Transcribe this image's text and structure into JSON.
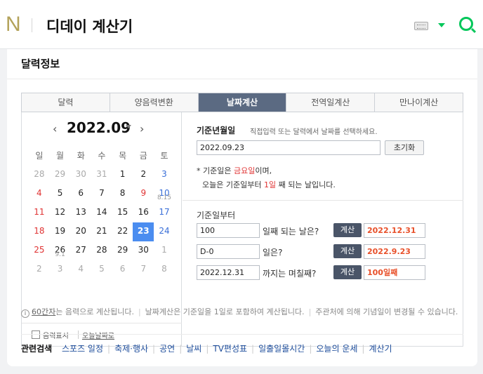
{
  "header": {
    "logo": "N",
    "query": "디데이 계산기"
  },
  "card": {
    "title": "달력정보"
  },
  "tabs": [
    {
      "label": "달력"
    },
    {
      "label": "양음력변환"
    },
    {
      "label": "날짜계산",
      "active": true
    },
    {
      "label": "전역일계산"
    },
    {
      "label": "만나이계산"
    }
  ],
  "calendar": {
    "month": "2022.09",
    "weekdays": [
      "일",
      "월",
      "화",
      "수",
      "목",
      "금",
      "토"
    ],
    "weeks": [
      [
        {
          "d": "28",
          "t": "other"
        },
        {
          "d": "29",
          "t": "other"
        },
        {
          "d": "30",
          "t": "other"
        },
        {
          "d": "31",
          "t": "other"
        },
        {
          "d": "1"
        },
        {
          "d": "2"
        },
        {
          "d": "3",
          "t": "sat"
        }
      ],
      [
        {
          "d": "4",
          "t": "sun"
        },
        {
          "d": "5"
        },
        {
          "d": "6"
        },
        {
          "d": "7"
        },
        {
          "d": "8"
        },
        {
          "d": "9",
          "t": "sun"
        },
        {
          "d": "10",
          "t": "sat",
          "sub": "8.15"
        }
      ],
      [
        {
          "d": "11",
          "t": "sun"
        },
        {
          "d": "12"
        },
        {
          "d": "13"
        },
        {
          "d": "14"
        },
        {
          "d": "15"
        },
        {
          "d": "16"
        },
        {
          "d": "17",
          "t": "sat"
        }
      ],
      [
        {
          "d": "18",
          "t": "sun"
        },
        {
          "d": "19"
        },
        {
          "d": "20"
        },
        {
          "d": "21"
        },
        {
          "d": "22"
        },
        {
          "d": "23",
          "t": "sel"
        },
        {
          "d": "24",
          "t": "sat"
        }
      ],
      [
        {
          "d": "25",
          "t": "sun"
        },
        {
          "d": "26",
          "sub": "9.1"
        },
        {
          "d": "27"
        },
        {
          "d": "28"
        },
        {
          "d": "29"
        },
        {
          "d": "30"
        },
        {
          "d": "1",
          "t": "other"
        }
      ],
      [
        {
          "d": "2",
          "t": "other"
        },
        {
          "d": "3",
          "t": "other"
        },
        {
          "d": "4",
          "t": "other"
        },
        {
          "d": "5",
          "t": "other"
        },
        {
          "d": "6",
          "t": "other"
        },
        {
          "d": "7",
          "t": "other"
        },
        {
          "d": "8",
          "t": "other"
        }
      ]
    ],
    "lunar_label": "음력표시",
    "today_link": "오늘날짜로"
  },
  "calc": {
    "base_label": "기준년월일",
    "base_hint": "직접입력 또는 달력에서 날짜를 선택하세요.",
    "base_value": "2022.09.23",
    "reset_label": "초기화",
    "info_prefix": "* 기준일은 ",
    "info_day": "금요일",
    "info_suffix": "이며,",
    "info2_prefix": "오늘은 기준일부터 ",
    "info2_day": "1일",
    "info2_suffix": " 째 되는 날입니다.",
    "from_label": "기준일부터",
    "rows": [
      {
        "input": "100",
        "label": "일째 되는 날은?",
        "button": "계산",
        "result": "2022.12.31"
      },
      {
        "input": "D-0",
        "label": "일은?",
        "button": "계산",
        "result": "2022.9.23"
      },
      {
        "input": "2022.12.31",
        "label": "까지는 며칠째?",
        "button": "계산",
        "result": "100일째"
      }
    ]
  },
  "note": {
    "icon": "i",
    "link": "60간자",
    "text1": "는 음력으로 계산됩니다.",
    "text2": "날짜계산은 기준일을 1일로 포함하여 계산됩니다.",
    "text3": "주관처에 의해 기념일이 변경될 수 있습니다."
  },
  "related": {
    "title": "관련검색",
    "items": [
      "스포즈 일정",
      "축제·행사",
      "공연",
      "날씨",
      "TV편성표",
      "일출일몰시간",
      "오늘의 운세",
      "계산기"
    ]
  },
  "colors": {
    "accent": "#03c75a",
    "tab_active": "#5b6a82",
    "selected_day": "#4b8df0",
    "result": "#e8502a"
  }
}
